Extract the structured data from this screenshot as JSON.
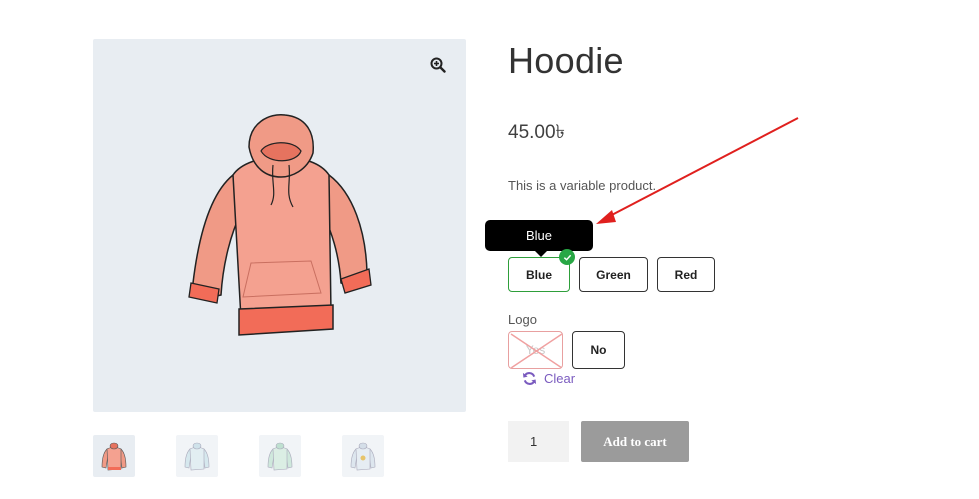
{
  "product": {
    "title": "Hoodie",
    "price": "45.00৳",
    "description": "This is a variable product."
  },
  "gallery": {
    "zoom_icon": "zoom-in-icon",
    "thumbnails": [
      "hoodie-red",
      "hoodie-blue",
      "hoodie-green",
      "hoodie-logo"
    ]
  },
  "color_attribute": {
    "tooltip": "Blue",
    "options": [
      "Blue",
      "Green",
      "Red"
    ],
    "selected": "Blue"
  },
  "logo_attribute": {
    "label": "Logo",
    "options": [
      "Yes",
      "No"
    ],
    "disabled": "Yes"
  },
  "clear": {
    "label": "Clear",
    "icon": "refresh-icon"
  },
  "cart": {
    "quantity": "1",
    "button": "Add to cart"
  },
  "colors": {
    "selected_border": "#2e9e3a",
    "check_badge": "#28a745",
    "arrow": "#e0201e",
    "clear_link": "#7a5bbf",
    "button_bg": "#9b9b9b"
  }
}
